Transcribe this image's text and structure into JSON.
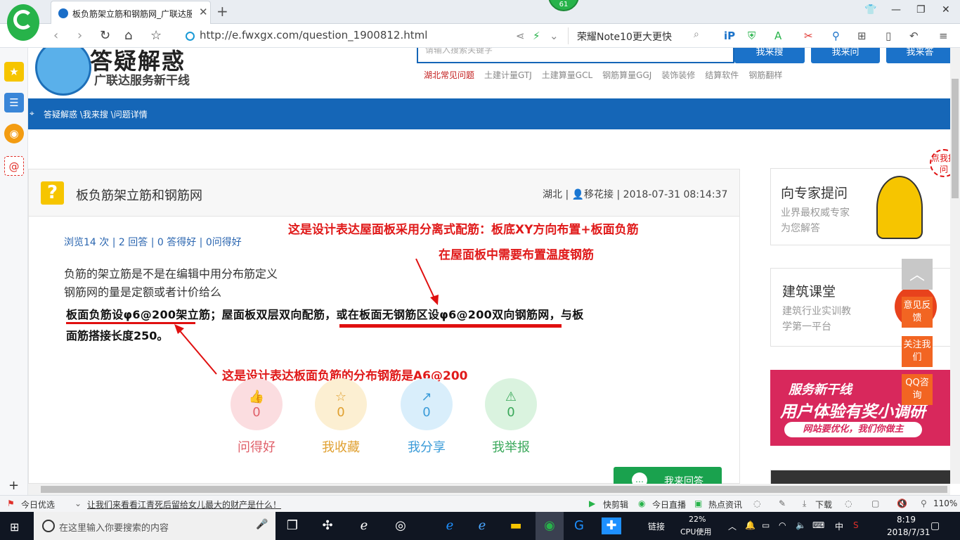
{
  "browser": {
    "tab_title": "板负筋架立筋和钢筋网_广联达服",
    "badge": "61",
    "url": "http://e.fwxgx.com/question_1900812.html",
    "search_text": "荣耀Note10更大更快"
  },
  "header": {
    "brand_title": "答疑解惑",
    "brand_slogan": "广联达服务新干线",
    "search_placeholder": "请输入搜索关键字",
    "buttons": [
      "我来搜",
      "我来问",
      "我来答"
    ],
    "links": [
      "湖北常见问题",
      "土建计量GTJ",
      "土建算量GCL",
      "钢筋算量GGJ",
      "装饰装修",
      "结算软件",
      "钢筋翻样"
    ]
  },
  "breadcrumb": "答疑解惑 \\我来搜 \\问题详情",
  "question": {
    "title": "板负筋架立筋和钢筋网",
    "meta": "湖北 | 👤移花接 | 2018-07-31 08:14:37",
    "stats": "浏览14 次 | 2 回答 | 0 答得好 | 0问得好",
    "line1": "负筋的架立筋是不是在编辑中用分布筋定义",
    "line2": "钢筋网的量是定额或者计价给么",
    "image_line1": "板面负筋设φ6@200架立筋；屋面板双层双向配筋，或在板面无钢筋区设φ6@200双向钢筋网，与板",
    "image_line2": "面筋搭接长度250。",
    "annotation1_line1": "这是设计表达屋面板采用分离式配筋：板底XY方向布置+板面负筋",
    "annotation1_line2": "在屋面板中需要布置温度钢筋",
    "annotation2": "这是设计表达板面负筋的分布钢筋是A6@200"
  },
  "actions": [
    {
      "label": "问得好",
      "count": "0",
      "color": "#e0606a",
      "bg": "#fbdde0",
      "icon": "👍"
    },
    {
      "label": "我收藏",
      "count": "0",
      "color": "#e0a030",
      "bg": "#fcefd2",
      "icon": "☆"
    },
    {
      "label": "我分享",
      "count": "0",
      "color": "#3a9bd8",
      "bg": "#d9eefb",
      "icon": "↗"
    },
    {
      "label": "我举报",
      "count": "0",
      "color": "#3aa85a",
      "bg": "#daf3df",
      "icon": "⚠"
    }
  ],
  "answer_button": "我来回答",
  "sidebar": {
    "expert_title": "向专家提问",
    "expert_sub1": "业界最权威专家",
    "expert_sub2": "为您解答",
    "expert_badge": "点我提问",
    "class_title": "建筑课堂",
    "class_sub1": "建筑行业实训教",
    "class_sub2": "学第一平台",
    "banner_line1": "服务新干线",
    "banner_line2": "用户体验有奖小调研",
    "banner_line3": "网站要优化，我们你做主"
  },
  "float_buttons": [
    "意见反馈",
    "关注我们",
    "QQ咨询"
  ],
  "statusbar": {
    "left": "今日优选",
    "news": "让我们来看看江青死后留给女儿最大的财产是什么！",
    "items": [
      "快剪辑",
      "今日直播",
      "热点资讯",
      "下载"
    ],
    "zoom": "110%"
  },
  "taskbar": {
    "search_placeholder": "在这里输入你要搜索的内容",
    "link_label": "链接",
    "cpu_percent": "22%",
    "cpu_label": "CPU使用",
    "ime": "中",
    "time": "8:19",
    "date": "2018/7/31"
  }
}
